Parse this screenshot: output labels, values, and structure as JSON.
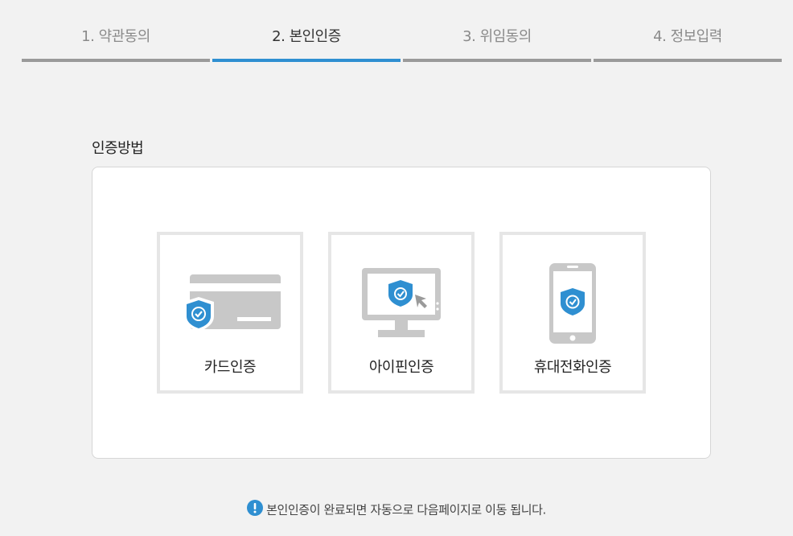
{
  "steps": [
    {
      "label": "1. 약관동의",
      "active": false
    },
    {
      "label": "2. 본인인증",
      "active": true
    },
    {
      "label": "3. 위임동의",
      "active": false
    },
    {
      "label": "4. 정보입력",
      "active": false
    }
  ],
  "colors": {
    "accent": "#2f8fd1",
    "inactive": "#9a9a9a",
    "icon_gray": "#c8c8c8"
  },
  "auth": {
    "title": "인증방법",
    "methods": [
      {
        "label": "카드인증",
        "icon": "card-shield-icon"
      },
      {
        "label": "아이핀인증",
        "icon": "monitor-shield-icon"
      },
      {
        "label": "휴대전화인증",
        "icon": "phone-shield-icon"
      }
    ]
  },
  "notice": {
    "icon": "exclamation-icon",
    "text": "본인인증이 완료되면 자동으로 다음페이지로 이동 됩니다."
  }
}
